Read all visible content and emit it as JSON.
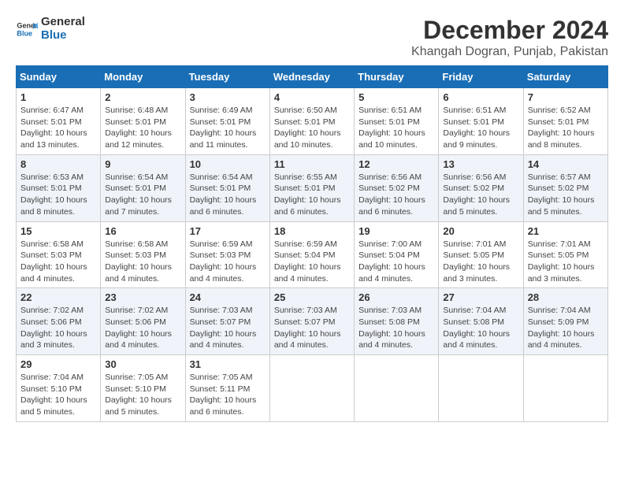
{
  "logo": {
    "line1": "General",
    "line2": "Blue"
  },
  "title": "December 2024",
  "location": "Khangah Dogran, Punjab, Pakistan",
  "weekdays": [
    "Sunday",
    "Monday",
    "Tuesday",
    "Wednesday",
    "Thursday",
    "Friday",
    "Saturday"
  ],
  "weeks": [
    [
      {
        "day": 1,
        "sunrise": "6:47 AM",
        "sunset": "5:01 PM",
        "daylight": "10 hours and 13 minutes."
      },
      {
        "day": 2,
        "sunrise": "6:48 AM",
        "sunset": "5:01 PM",
        "daylight": "10 hours and 12 minutes."
      },
      {
        "day": 3,
        "sunrise": "6:49 AM",
        "sunset": "5:01 PM",
        "daylight": "10 hours and 11 minutes."
      },
      {
        "day": 4,
        "sunrise": "6:50 AM",
        "sunset": "5:01 PM",
        "daylight": "10 hours and 10 minutes."
      },
      {
        "day": 5,
        "sunrise": "6:51 AM",
        "sunset": "5:01 PM",
        "daylight": "10 hours and 10 minutes."
      },
      {
        "day": 6,
        "sunrise": "6:51 AM",
        "sunset": "5:01 PM",
        "daylight": "10 hours and 9 minutes."
      },
      {
        "day": 7,
        "sunrise": "6:52 AM",
        "sunset": "5:01 PM",
        "daylight": "10 hours and 8 minutes."
      }
    ],
    [
      {
        "day": 8,
        "sunrise": "6:53 AM",
        "sunset": "5:01 PM",
        "daylight": "10 hours and 8 minutes."
      },
      {
        "day": 9,
        "sunrise": "6:54 AM",
        "sunset": "5:01 PM",
        "daylight": "10 hours and 7 minutes."
      },
      {
        "day": 10,
        "sunrise": "6:54 AM",
        "sunset": "5:01 PM",
        "daylight": "10 hours and 6 minutes."
      },
      {
        "day": 11,
        "sunrise": "6:55 AM",
        "sunset": "5:01 PM",
        "daylight": "10 hours and 6 minutes."
      },
      {
        "day": 12,
        "sunrise": "6:56 AM",
        "sunset": "5:02 PM",
        "daylight": "10 hours and 6 minutes."
      },
      {
        "day": 13,
        "sunrise": "6:56 AM",
        "sunset": "5:02 PM",
        "daylight": "10 hours and 5 minutes."
      },
      {
        "day": 14,
        "sunrise": "6:57 AM",
        "sunset": "5:02 PM",
        "daylight": "10 hours and 5 minutes."
      }
    ],
    [
      {
        "day": 15,
        "sunrise": "6:58 AM",
        "sunset": "5:03 PM",
        "daylight": "10 hours and 4 minutes."
      },
      {
        "day": 16,
        "sunrise": "6:58 AM",
        "sunset": "5:03 PM",
        "daylight": "10 hours and 4 minutes."
      },
      {
        "day": 17,
        "sunrise": "6:59 AM",
        "sunset": "5:03 PM",
        "daylight": "10 hours and 4 minutes."
      },
      {
        "day": 18,
        "sunrise": "6:59 AM",
        "sunset": "5:04 PM",
        "daylight": "10 hours and 4 minutes."
      },
      {
        "day": 19,
        "sunrise": "7:00 AM",
        "sunset": "5:04 PM",
        "daylight": "10 hours and 4 minutes."
      },
      {
        "day": 20,
        "sunrise": "7:01 AM",
        "sunset": "5:05 PM",
        "daylight": "10 hours and 3 minutes."
      },
      {
        "day": 21,
        "sunrise": "7:01 AM",
        "sunset": "5:05 PM",
        "daylight": "10 hours and 3 minutes."
      }
    ],
    [
      {
        "day": 22,
        "sunrise": "7:02 AM",
        "sunset": "5:06 PM",
        "daylight": "10 hours and 3 minutes."
      },
      {
        "day": 23,
        "sunrise": "7:02 AM",
        "sunset": "5:06 PM",
        "daylight": "10 hours and 4 minutes."
      },
      {
        "day": 24,
        "sunrise": "7:03 AM",
        "sunset": "5:07 PM",
        "daylight": "10 hours and 4 minutes."
      },
      {
        "day": 25,
        "sunrise": "7:03 AM",
        "sunset": "5:07 PM",
        "daylight": "10 hours and 4 minutes."
      },
      {
        "day": 26,
        "sunrise": "7:03 AM",
        "sunset": "5:08 PM",
        "daylight": "10 hours and 4 minutes."
      },
      {
        "day": 27,
        "sunrise": "7:04 AM",
        "sunset": "5:08 PM",
        "daylight": "10 hours and 4 minutes."
      },
      {
        "day": 28,
        "sunrise": "7:04 AM",
        "sunset": "5:09 PM",
        "daylight": "10 hours and 4 minutes."
      }
    ],
    [
      {
        "day": 29,
        "sunrise": "7:04 AM",
        "sunset": "5:10 PM",
        "daylight": "10 hours and 5 minutes."
      },
      {
        "day": 30,
        "sunrise": "7:05 AM",
        "sunset": "5:10 PM",
        "daylight": "10 hours and 5 minutes."
      },
      {
        "day": 31,
        "sunrise": "7:05 AM",
        "sunset": "5:11 PM",
        "daylight": "10 hours and 6 minutes."
      },
      null,
      null,
      null,
      null
    ]
  ]
}
